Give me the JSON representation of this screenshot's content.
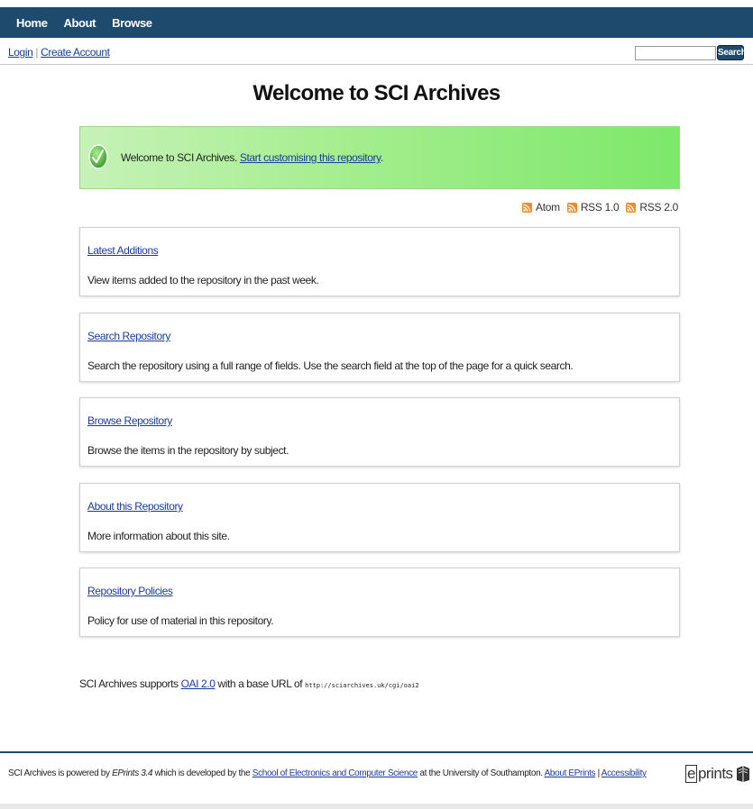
{
  "nav": {
    "home": "Home",
    "about": "About",
    "browse": "Browse"
  },
  "account": {
    "login": "Login",
    "separator": "|",
    "create": "Create Account"
  },
  "search": {
    "button_label": "Search",
    "value": ""
  },
  "page_title": "Welcome to SCI Archives",
  "welcome": {
    "text": "Welcome to SCI Archives.",
    "link": "Start customising this repository",
    "suffix": "."
  },
  "feeds": [
    {
      "label": "Atom",
      "icon": "rss-icon"
    },
    {
      "label": "RSS 1.0",
      "icon": "rss-icon"
    },
    {
      "label": "RSS 2.0",
      "icon": "rss-icon"
    }
  ],
  "cards": [
    {
      "title": "Latest Additions",
      "description": "View items added to the repository in the past week."
    },
    {
      "title": "Search Repository",
      "description": "Search the repository using a full range of fields. Use the search field at the top of the page for a quick search."
    },
    {
      "title": "Browse Repository",
      "description": "Browse the items in the repository by subject."
    },
    {
      "title": "About this Repository",
      "description": "More information about this site."
    },
    {
      "title": "Repository Policies",
      "description": "Policy for use of material in this repository."
    }
  ],
  "oai": {
    "prefix": "SCI Archives supports",
    "link": "OAI 2.0",
    "middle": "with a base URL of",
    "url": "http://sciarchives.uk/cgi/oai2"
  },
  "footer": {
    "t1": "SCI Archives is powered by",
    "software": "EPrints 3.4",
    "t2": "which is developed by the",
    "school_link": "School of Electronics and Computer Science",
    "t3": "at the University of Southampton.",
    "about_link": "About EPrints",
    "separator": "|",
    "access_link": "Accessibility",
    "logo_e": "e",
    "logo_rest": "prints"
  },
  "colors": {
    "nav_bg": "#1e4a6e",
    "link": "#1a3d99",
    "success_green": "#7de86a",
    "rss_orange": "#f08a24"
  }
}
